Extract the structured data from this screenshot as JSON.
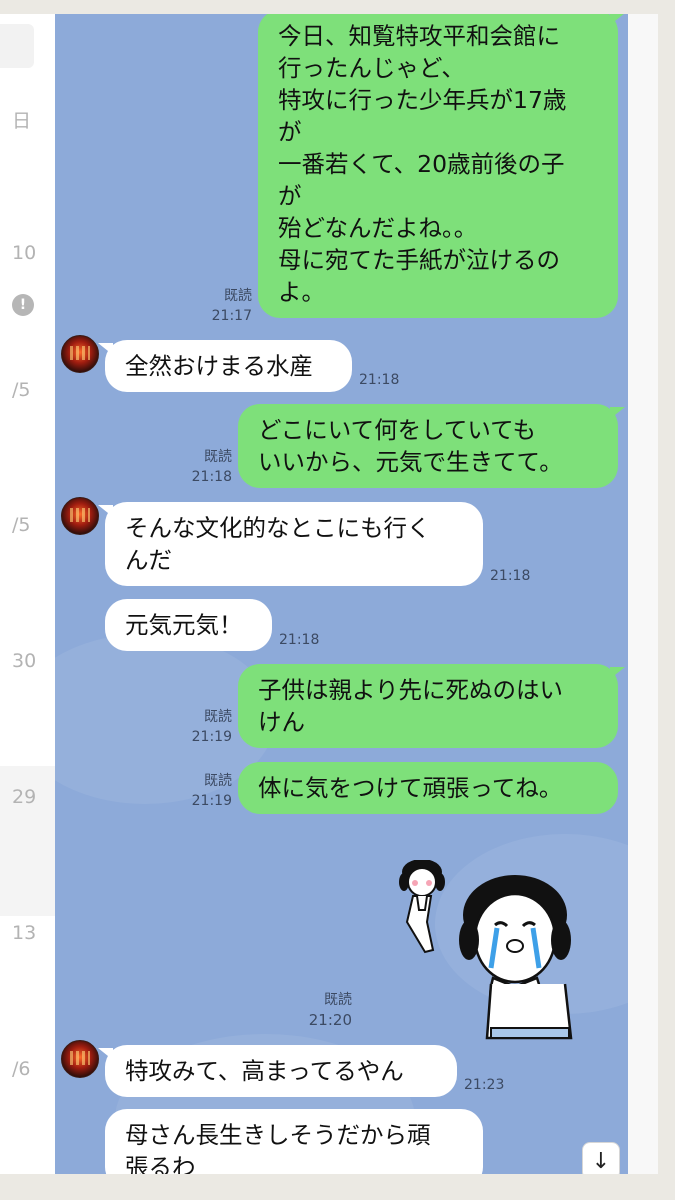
{
  "sidebar": {
    "labels": [
      "日",
      "10",
      "/5",
      "/5",
      "30",
      "29",
      "13",
      "/6"
    ],
    "alert_glyph": "!"
  },
  "messages": [
    {
      "side": "me",
      "text": "今日、知覧特攻平和会館に\n行ったんじゃど、\n特攻に行った少年兵が17歳\nが\n一番若くて、20歳前後の子\nが\n殆どなんだよね。。\n母に宛てた手紙が泣けるの\nよ。",
      "read": "既読",
      "time": "21:17"
    },
    {
      "side": "them",
      "text": "全然おけまる水産",
      "time": "21:18"
    },
    {
      "side": "me",
      "text": "どこにいて何をしていても\nいいから、元気で生きてて。",
      "read": "既読",
      "time": "21:18"
    },
    {
      "side": "them",
      "text": "そんな文化的なとこにも行く\nんだ",
      "time": "21:18"
    },
    {
      "side": "them",
      "text": "元気元気！",
      "time": "21:18"
    },
    {
      "side": "me",
      "text": "子供は親より先に死ぬのはい\nけん",
      "read": "既読",
      "time": "21:19"
    },
    {
      "side": "me",
      "text": "体に気をつけて頑張ってね。",
      "read": "既読",
      "time": "21:19"
    },
    {
      "side": "me",
      "type": "sticker",
      "read": "既読",
      "time": "21:20"
    },
    {
      "side": "them",
      "text": "特攻みて、高まってるやん",
      "time": "21:23"
    },
    {
      "side": "them",
      "text": "母さん長生きしそうだから頑\n張るわ",
      "time": ""
    }
  ],
  "scroll_down_icon": "↓",
  "colors": {
    "chat_bg": "#8daad9",
    "my_bubble": "#7ee07a",
    "their_bubble": "#ffffff"
  }
}
